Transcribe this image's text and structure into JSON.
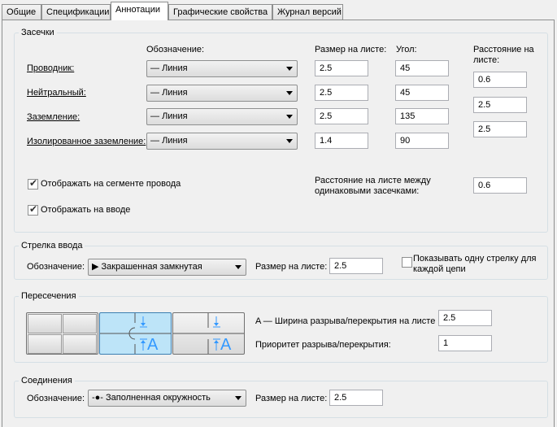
{
  "tabs": [
    "Общие",
    "Спецификации",
    "Аннотации",
    "Графические свойства",
    "Журнал версий"
  ],
  "ticks": {
    "title": "Засечки",
    "col_designation": "Обозначение:",
    "col_size": "Размер на листе:",
    "col_angle": "Угол:",
    "col_distance": "Расстояние на листе:",
    "rows": [
      {
        "label": "Проводник:",
        "designation": "Линия",
        "size": "2.5",
        "angle": "45",
        "distance": "0.6"
      },
      {
        "label": "Нейтральный:",
        "designation": "Линия",
        "size": "2.5",
        "angle": "45",
        "distance": "2.5"
      },
      {
        "label": "Заземление:",
        "designation": "Линия",
        "size": "2.5",
        "angle": "135",
        "distance": "2.5"
      },
      {
        "label": "Изолированное заземление:",
        "designation": "Линия",
        "size": "1.4",
        "angle": "90",
        "distance": ""
      }
    ],
    "show_on_segment": "Отображать на сегменте провода",
    "show_on_home_run": "Отображать на вводе",
    "spacing_label": "Расстояние на листе между одинаковыми засечками:",
    "spacing_value": "0.6"
  },
  "home_run": {
    "title": "Стрелка ввода",
    "designation_label": "Обозначение:",
    "designation_value": "Закрашенная замкнутая",
    "size_label": "Размер на листе:",
    "size_value": "2.5",
    "single_arrow_label": "Показывать одну стрелку для каждой цепи"
  },
  "crossings": {
    "title": "Пересечения",
    "gap_label": "A — Ширина разрыва/перекрытия на листе",
    "gap_value": "2.5",
    "priority_label": "Приоритет разрыва/перекрытия:",
    "priority_value": "1",
    "letter": "A",
    "selected_option": 2
  },
  "connections": {
    "title": "Соединения",
    "designation_label": "Обозначение:",
    "designation_value": "Заполненная окружность",
    "size_label": "Размер на листе:",
    "size_value": "2.5"
  },
  "colors": {
    "selection": "#bde4f8",
    "selection_border": "#3c7fb1",
    "accent": "#3399ff"
  }
}
